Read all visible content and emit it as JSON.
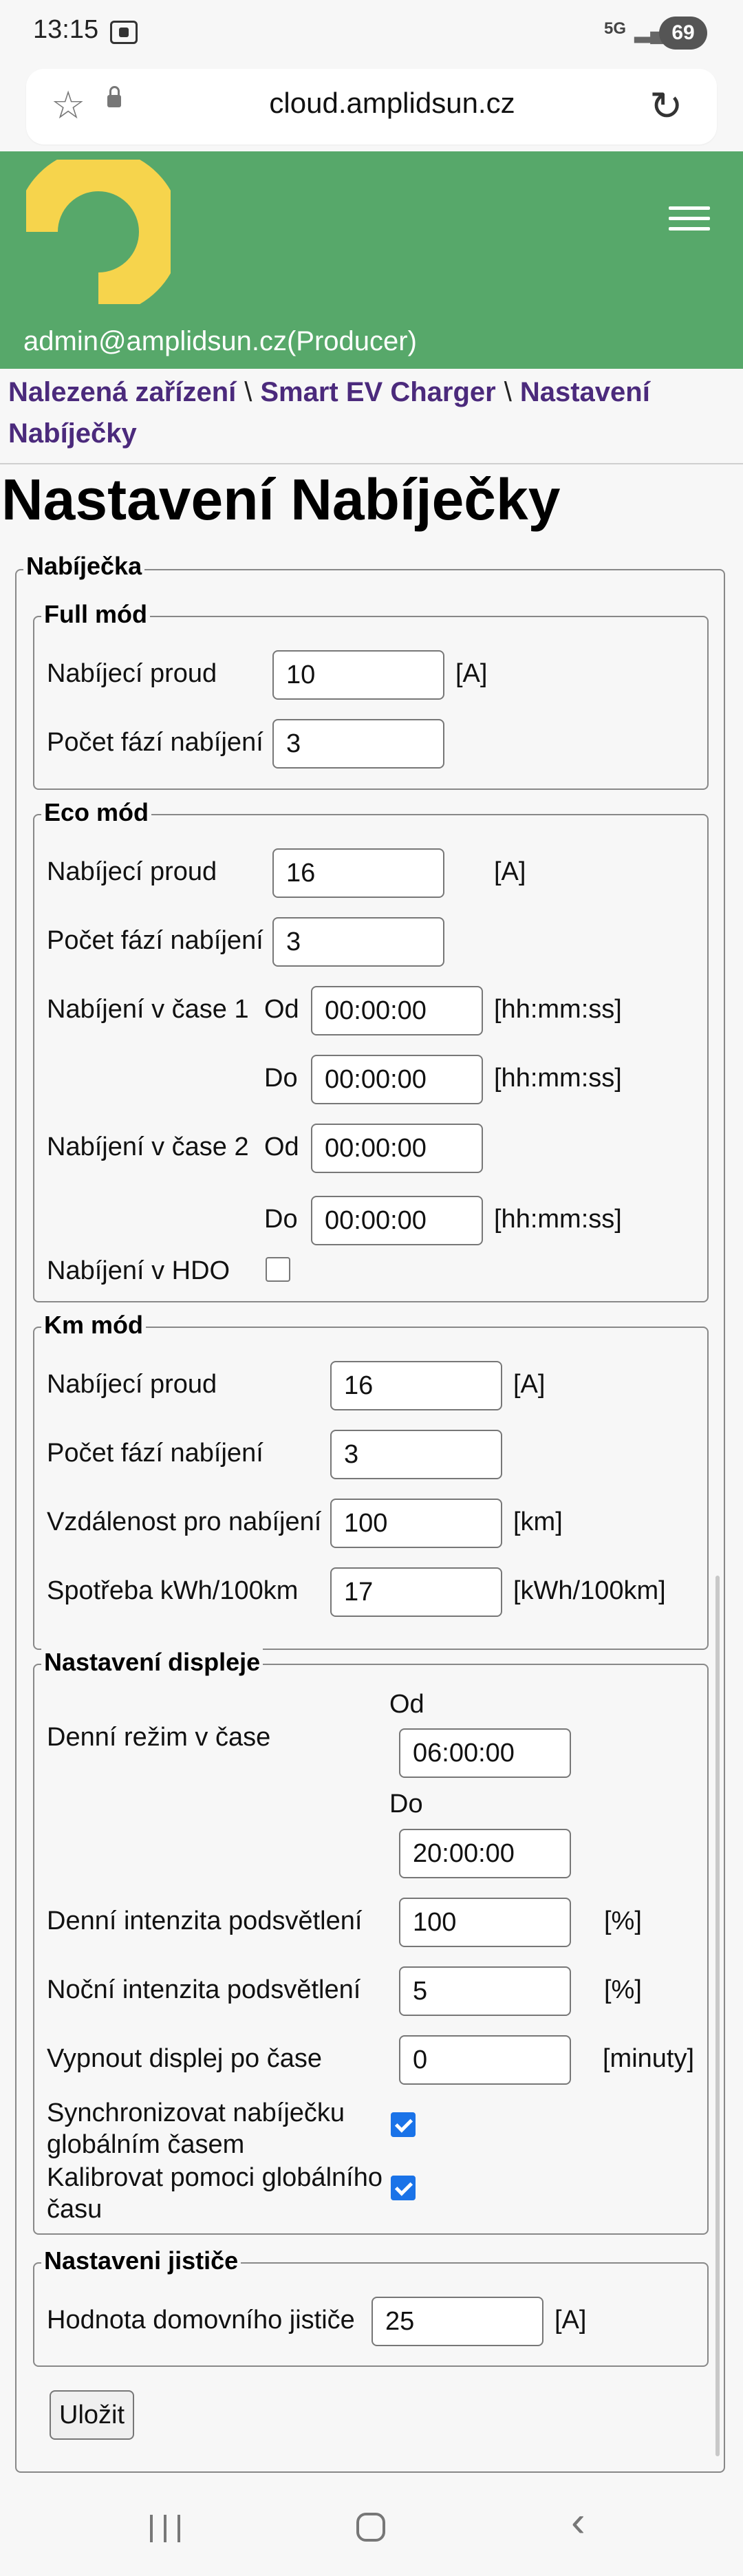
{
  "status_bar": {
    "time": "13:15",
    "network": "5G",
    "battery": "69"
  },
  "browser": {
    "url": "cloud.amplidsun.cz"
  },
  "header": {
    "user": "admin@amplidsun.cz(Producer)",
    "colors": {
      "header_bg": "#57a86a",
      "logo": "#f6d44c",
      "link": "#4b2a7c"
    }
  },
  "breadcrumb": {
    "items": [
      "Nalezená zařízení",
      "Smart EV Charger",
      "Nastavení Nabíječky"
    ],
    "separator": "\\"
  },
  "page_title": "Nastavení Nabíječky",
  "form": {
    "legend": "Nabíječka",
    "full": {
      "legend": "Full mód",
      "current_label": "Nabíjecí proud",
      "current_value": "10",
      "current_unit": "[A]",
      "phases_label": "Počet fází nabíjení",
      "phases_value": "3"
    },
    "eco": {
      "legend": "Eco mód",
      "current_label": "Nabíjecí proud",
      "current_value": "16",
      "current_unit": "[A]",
      "phases_label": "Počet fází nabíjení",
      "phases_value": "3",
      "time1_label": "Nabíjení v čase 1",
      "time2_label": "Nabíjení v čase 2",
      "from_label": "Od",
      "to_label": "Do",
      "time1_from": "00:00:00",
      "time1_to": "00:00:00",
      "time2_from": "00:00:00",
      "time2_to": "00:00:00",
      "time_unit": "[hh:mm:ss]",
      "hdo_label": "Nabíjení v HDO",
      "hdo_checked": false
    },
    "km": {
      "legend": "Km mód",
      "current_label": "Nabíjecí proud",
      "current_value": "16",
      "current_unit": "[A]",
      "phases_label": "Počet fází nabíjení",
      "phases_value": "3",
      "distance_label": "Vzdálenost pro nabíjení",
      "distance_value": "100",
      "distance_unit": "[km]",
      "consumption_label": "Spotřeba kWh/100km",
      "consumption_value": "17",
      "consumption_unit": "[kWh/100km]"
    },
    "display": {
      "legend": "Nastavení displeje",
      "day_mode_label": "Denní režim v čase",
      "from_label": "Od",
      "from_value": "06:00:00",
      "to_label": "Do",
      "to_value": "20:00:00",
      "day_intensity_label": "Denní intenzita podsvětlení",
      "day_intensity_value": "100",
      "day_intensity_unit": "[%]",
      "night_intensity_label": "Noční intenzita podsvětlení",
      "night_intensity_value": "5",
      "night_intensity_unit": "[%]",
      "off_label": "Vypnout displej po čase",
      "off_value": "0",
      "off_unit": "[minuty]",
      "sync_label_1": "Synchronizovat nabíječku",
      "sync_label_2": "globálním časem",
      "sync_checked": true,
      "calib_label_1": "Kalibrovat pomoci globálního",
      "calib_label_2": "času",
      "calib_checked": true
    },
    "breaker": {
      "legend": "Nastaveni jističe",
      "value_label": "Hodnota domovního jističe",
      "value": "25",
      "unit": "[A]"
    },
    "save_label": "Uložit"
  }
}
